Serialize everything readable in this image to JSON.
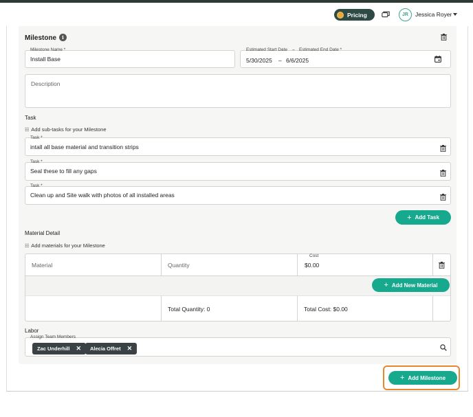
{
  "header": {
    "pricing_label": "Pricing",
    "avatar_initials": "JR",
    "user_name": "Jessica Royer"
  },
  "milestone": {
    "title": "Milestone",
    "name_label": "Milestone Name *",
    "name_value": "Install Base",
    "dates_label_start": "Estimated Start Date",
    "dates_label_sep": "–",
    "dates_label_end": "Estimated End Date *",
    "start_date": "5/30/2025",
    "date_separator": "–",
    "end_date": "6/6/2025",
    "description_placeholder": "Description"
  },
  "tasks": {
    "section_label": "Task",
    "hint": "Add sub-tasks for your Milestone",
    "field_label": "Task *",
    "items": [
      "intall all base material and transition strips",
      "Seal these to fill any gaps",
      "Clean up and Site walk with photos of all installed areas"
    ],
    "add_button": "Add Task"
  },
  "materials": {
    "section_label": "Material Detail",
    "hint": "Add materials for your Milestone",
    "material_placeholder": "Material",
    "quantity_placeholder": "Quantity",
    "cost_label": "Cost",
    "cost_value": "$0.00",
    "add_button": "Add New Material",
    "total_quantity": "Total Quantity: 0",
    "total_cost": "Total Cost: $0.00"
  },
  "labor": {
    "section_label": "Labor",
    "field_label": "Assign Team Members",
    "members": [
      "Zac Underhill",
      "Alecia Offret"
    ]
  },
  "footer": {
    "add_milestone_button": "Add Milestone"
  },
  "colors": {
    "accent_green": "#16a98e",
    "highlight_orange": "#e8862e",
    "chip_dark": "#3a4245"
  }
}
